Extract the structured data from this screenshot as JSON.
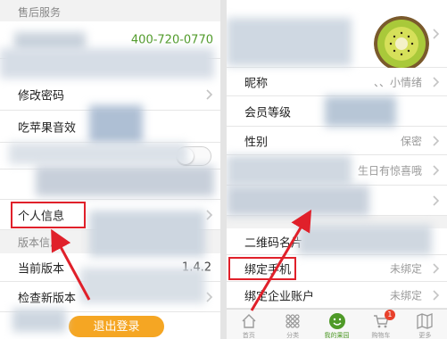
{
  "left": {
    "section_after_sales": "售后服务",
    "service_phone": "400-720-0770",
    "change_password": "修改密码",
    "apple_sound": "吃苹果音效",
    "personal_info": "个人信息",
    "section_version": "版本信息",
    "current_version_label": "当前版本",
    "current_version_value": "1.4.2",
    "check_update": "检查新版本",
    "logout": "退出登录"
  },
  "right": {
    "nickname_label": "昵称",
    "nickname_value": "、、小情绪",
    "member_level_label": "会员等级",
    "gender_label": "性别",
    "gender_value": "保密",
    "birthday_value": "生日有惊喜哦",
    "qr_label": "二维码名片",
    "bind_phone_label": "绑定手机",
    "bind_phone_value": "未绑定",
    "bind_company_label": "绑定企业账户",
    "bind_company_value": "未绑定",
    "avatar_icon": "kiwi-avatar",
    "tabs": [
      {
        "label": "首页",
        "icon": "home-icon"
      },
      {
        "label": "分类",
        "icon": "grid-icon"
      },
      {
        "label": "我的果园",
        "icon": "smile-icon"
      },
      {
        "label": "购物车",
        "icon": "cart-icon",
        "badge": "1"
      },
      {
        "label": "更多",
        "icon": "map-icon"
      }
    ]
  },
  "colors": {
    "accent_green": "#4f9a28",
    "logout_orange": "#f5a623",
    "annotation_red": "#e0202a",
    "badge_red": "#e8412c"
  }
}
